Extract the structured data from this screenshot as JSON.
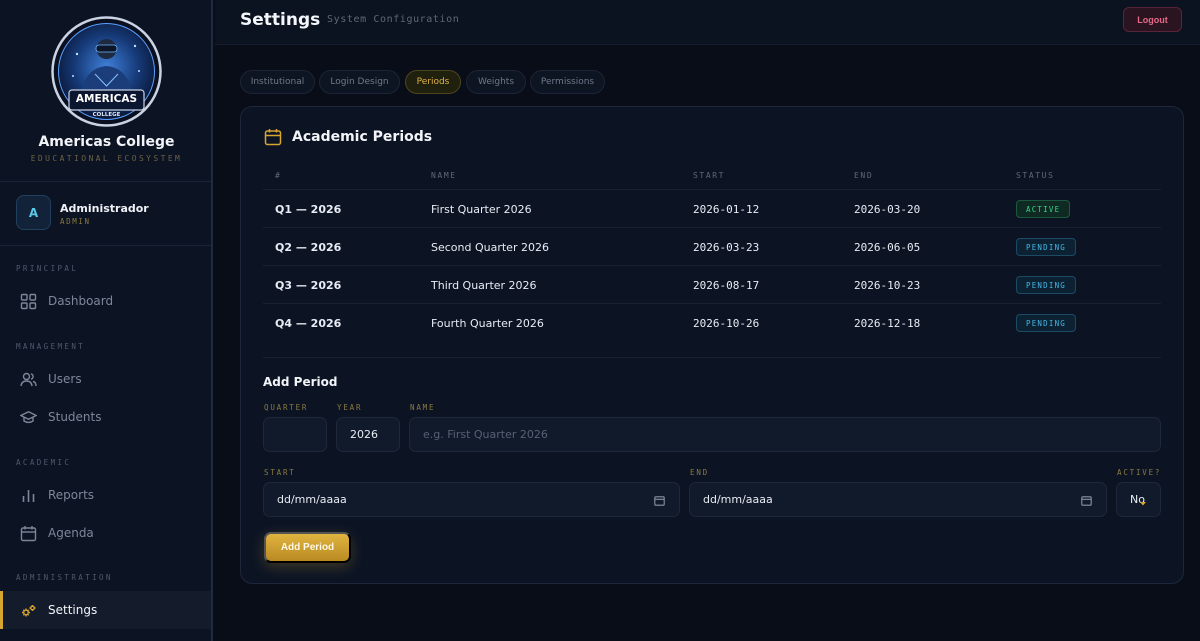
{
  "brand": {
    "name": "Americas College",
    "subtitle": "EDUCATIONAL ECOSYSTEM",
    "logo_text_line1": "AMERICAS",
    "logo_text_line2": "COLLEGE"
  },
  "user": {
    "initial": "A",
    "name": "Administrador",
    "role": "ADMIN"
  },
  "sidebar": {
    "sections": [
      {
        "title": "PRINCIPAL",
        "items": [
          {
            "label": "Dashboard",
            "icon": "grid-icon"
          }
        ]
      },
      {
        "title": "MANAGEMENT",
        "items": [
          {
            "label": "Users",
            "icon": "users-icon"
          },
          {
            "label": "Students",
            "icon": "graduation-cap-icon"
          }
        ]
      },
      {
        "title": "ACADEMIC",
        "items": [
          {
            "label": "Reports",
            "icon": "bar-chart-icon"
          },
          {
            "label": "Agenda",
            "icon": "calendar-icon"
          }
        ]
      },
      {
        "title": "ADMINISTRATION",
        "items": [
          {
            "label": "Settings",
            "icon": "settings-icon",
            "active": true
          }
        ]
      }
    ]
  },
  "header": {
    "title": "Settings",
    "subtitle": "System Configuration",
    "logout_label": "Logout"
  },
  "tabs": [
    {
      "label": "Institutional"
    },
    {
      "label": "Login Design"
    },
    {
      "label": "Periods",
      "active": true
    },
    {
      "label": "Weights"
    },
    {
      "label": "Permissions"
    }
  ],
  "periods": {
    "title": "Academic Periods",
    "columns": [
      "#",
      "NAME",
      "START",
      "END",
      "STATUS"
    ],
    "rows": [
      {
        "period": "Q1 — 2026",
        "name": "First Quarter 2026",
        "start": "2026-01-12",
        "end": "2026-03-20",
        "status": "ACTIVE"
      },
      {
        "period": "Q2 — 2026",
        "name": "Second Quarter 2026",
        "start": "2026-03-23",
        "end": "2026-06-05",
        "status": "PENDING"
      },
      {
        "period": "Q3 — 2026",
        "name": "Third Quarter 2026",
        "start": "2026-08-17",
        "end": "2026-10-23",
        "status": "PENDING"
      },
      {
        "period": "Q4 — 2026",
        "name": "Fourth Quarter 2026",
        "start": "2026-10-26",
        "end": "2026-12-18",
        "status": "PENDING"
      }
    ]
  },
  "add_period": {
    "title": "Add Period",
    "quarter_label": "QUARTER",
    "quarter_value": "",
    "year_label": "YEAR",
    "year_value": "2026",
    "name_label": "NAME",
    "name_placeholder": "e.g. First Quarter 2026",
    "start_label": "START",
    "start_value": "dd/mm/aaaa",
    "end_label": "END",
    "end_value": "dd/mm/aaaa",
    "active_label": "ACTIVE?",
    "active_value": "No",
    "submit_label": "Add Period"
  },
  "colors": {
    "accent": "#d7a630",
    "background": "#080d18",
    "active_badge": "#36d38a",
    "pending_badge": "#45b6e6",
    "logout": "#e56a8a"
  }
}
